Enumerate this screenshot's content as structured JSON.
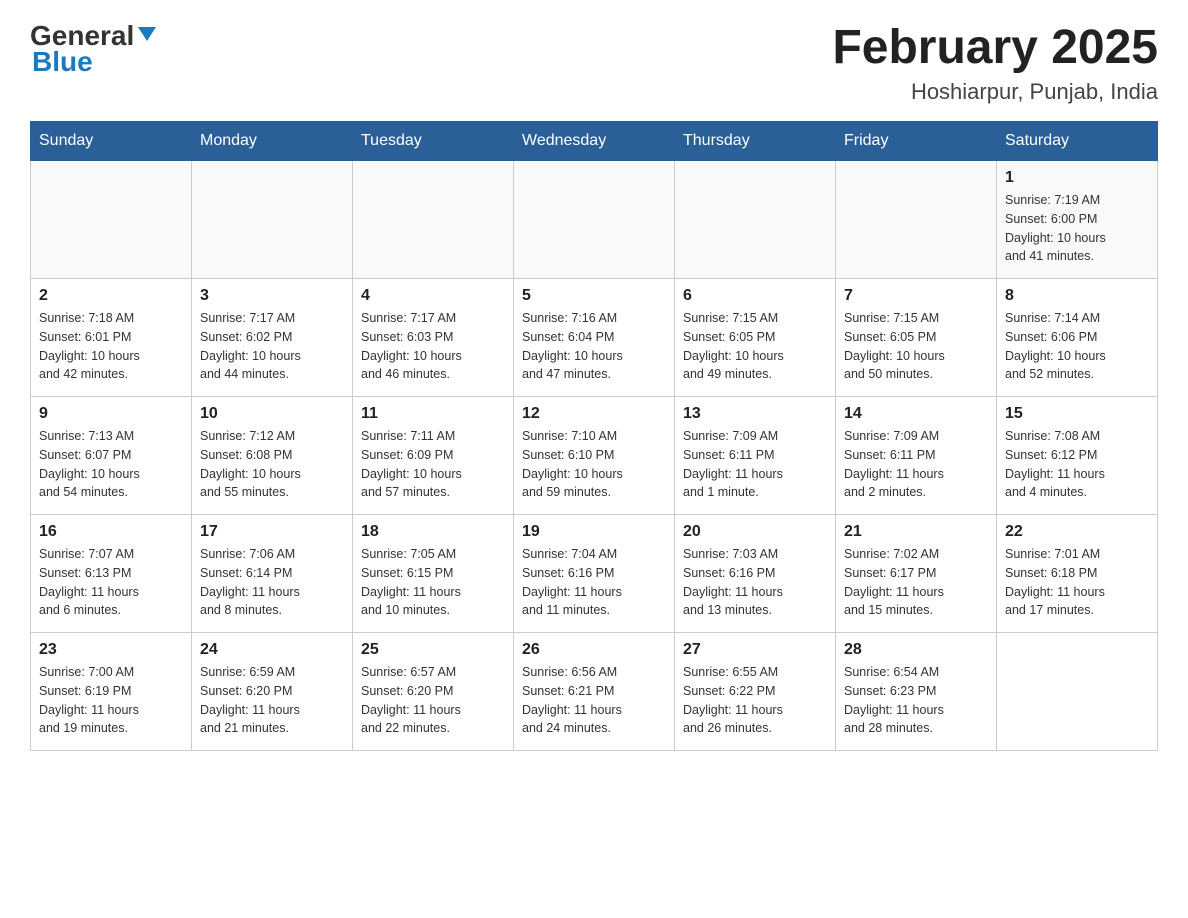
{
  "header": {
    "logo_general": "General",
    "logo_blue": "Blue",
    "title": "February 2025",
    "subtitle": "Hoshiarpur, Punjab, India"
  },
  "weekdays": [
    "Sunday",
    "Monday",
    "Tuesday",
    "Wednesday",
    "Thursday",
    "Friday",
    "Saturday"
  ],
  "weeks": [
    [
      {
        "day": "",
        "info": ""
      },
      {
        "day": "",
        "info": ""
      },
      {
        "day": "",
        "info": ""
      },
      {
        "day": "",
        "info": ""
      },
      {
        "day": "",
        "info": ""
      },
      {
        "day": "",
        "info": ""
      },
      {
        "day": "1",
        "info": "Sunrise: 7:19 AM\nSunset: 6:00 PM\nDaylight: 10 hours\nand 41 minutes."
      }
    ],
    [
      {
        "day": "2",
        "info": "Sunrise: 7:18 AM\nSunset: 6:01 PM\nDaylight: 10 hours\nand 42 minutes."
      },
      {
        "day": "3",
        "info": "Sunrise: 7:17 AM\nSunset: 6:02 PM\nDaylight: 10 hours\nand 44 minutes."
      },
      {
        "day": "4",
        "info": "Sunrise: 7:17 AM\nSunset: 6:03 PM\nDaylight: 10 hours\nand 46 minutes."
      },
      {
        "day": "5",
        "info": "Sunrise: 7:16 AM\nSunset: 6:04 PM\nDaylight: 10 hours\nand 47 minutes."
      },
      {
        "day": "6",
        "info": "Sunrise: 7:15 AM\nSunset: 6:05 PM\nDaylight: 10 hours\nand 49 minutes."
      },
      {
        "day": "7",
        "info": "Sunrise: 7:15 AM\nSunset: 6:05 PM\nDaylight: 10 hours\nand 50 minutes."
      },
      {
        "day": "8",
        "info": "Sunrise: 7:14 AM\nSunset: 6:06 PM\nDaylight: 10 hours\nand 52 minutes."
      }
    ],
    [
      {
        "day": "9",
        "info": "Sunrise: 7:13 AM\nSunset: 6:07 PM\nDaylight: 10 hours\nand 54 minutes."
      },
      {
        "day": "10",
        "info": "Sunrise: 7:12 AM\nSunset: 6:08 PM\nDaylight: 10 hours\nand 55 minutes."
      },
      {
        "day": "11",
        "info": "Sunrise: 7:11 AM\nSunset: 6:09 PM\nDaylight: 10 hours\nand 57 minutes."
      },
      {
        "day": "12",
        "info": "Sunrise: 7:10 AM\nSunset: 6:10 PM\nDaylight: 10 hours\nand 59 minutes."
      },
      {
        "day": "13",
        "info": "Sunrise: 7:09 AM\nSunset: 6:11 PM\nDaylight: 11 hours\nand 1 minute."
      },
      {
        "day": "14",
        "info": "Sunrise: 7:09 AM\nSunset: 6:11 PM\nDaylight: 11 hours\nand 2 minutes."
      },
      {
        "day": "15",
        "info": "Sunrise: 7:08 AM\nSunset: 6:12 PM\nDaylight: 11 hours\nand 4 minutes."
      }
    ],
    [
      {
        "day": "16",
        "info": "Sunrise: 7:07 AM\nSunset: 6:13 PM\nDaylight: 11 hours\nand 6 minutes."
      },
      {
        "day": "17",
        "info": "Sunrise: 7:06 AM\nSunset: 6:14 PM\nDaylight: 11 hours\nand 8 minutes."
      },
      {
        "day": "18",
        "info": "Sunrise: 7:05 AM\nSunset: 6:15 PM\nDaylight: 11 hours\nand 10 minutes."
      },
      {
        "day": "19",
        "info": "Sunrise: 7:04 AM\nSunset: 6:16 PM\nDaylight: 11 hours\nand 11 minutes."
      },
      {
        "day": "20",
        "info": "Sunrise: 7:03 AM\nSunset: 6:16 PM\nDaylight: 11 hours\nand 13 minutes."
      },
      {
        "day": "21",
        "info": "Sunrise: 7:02 AM\nSunset: 6:17 PM\nDaylight: 11 hours\nand 15 minutes."
      },
      {
        "day": "22",
        "info": "Sunrise: 7:01 AM\nSunset: 6:18 PM\nDaylight: 11 hours\nand 17 minutes."
      }
    ],
    [
      {
        "day": "23",
        "info": "Sunrise: 7:00 AM\nSunset: 6:19 PM\nDaylight: 11 hours\nand 19 minutes."
      },
      {
        "day": "24",
        "info": "Sunrise: 6:59 AM\nSunset: 6:20 PM\nDaylight: 11 hours\nand 21 minutes."
      },
      {
        "day": "25",
        "info": "Sunrise: 6:57 AM\nSunset: 6:20 PM\nDaylight: 11 hours\nand 22 minutes."
      },
      {
        "day": "26",
        "info": "Sunrise: 6:56 AM\nSunset: 6:21 PM\nDaylight: 11 hours\nand 24 minutes."
      },
      {
        "day": "27",
        "info": "Sunrise: 6:55 AM\nSunset: 6:22 PM\nDaylight: 11 hours\nand 26 minutes."
      },
      {
        "day": "28",
        "info": "Sunrise: 6:54 AM\nSunset: 6:23 PM\nDaylight: 11 hours\nand 28 minutes."
      },
      {
        "day": "",
        "info": ""
      }
    ]
  ]
}
